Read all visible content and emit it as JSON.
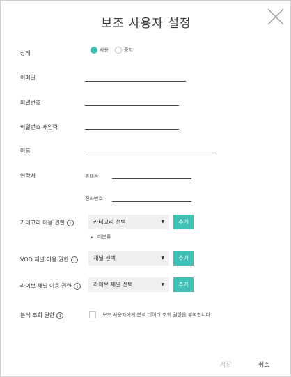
{
  "dialog": {
    "title": "보조 사용자 설정"
  },
  "fields": {
    "status": {
      "label": "상태",
      "options": [
        {
          "label": "사용",
          "checked": true
        },
        {
          "label": "중지",
          "checked": false
        }
      ]
    },
    "email": {
      "label": "이메일",
      "value": ""
    },
    "password": {
      "label": "비밀번호",
      "value": ""
    },
    "password_confirm": {
      "label": "비밀번호 재입력",
      "value": ""
    },
    "name": {
      "label": "이름",
      "value": ""
    },
    "contact": {
      "label": "연락처",
      "mobile_label": "휴대폰",
      "mobile_value": "",
      "phone_label": "전화번호",
      "phone_value": ""
    },
    "category_permission": {
      "label": "카테고리 이용 권한",
      "select_value": "카테고리 선택",
      "add_label": "추가",
      "tree_item": "미분류"
    },
    "vod_permission": {
      "label": "VOD 채널 이용 권한",
      "select_value": "채널 선택",
      "add_label": "추가"
    },
    "live_permission": {
      "label": "라이브 채널 이용 권한",
      "select_value": "라이브 채널 선택",
      "add_label": "추가"
    },
    "analytics_permission": {
      "label": "분석 조회 권한",
      "checkbox_label": "보조 사용자에게 분석 데이터 조회 권한을 부여합니다.",
      "checked": false
    }
  },
  "footer": {
    "save_label": "저장",
    "cancel_label": "취소"
  },
  "colors": {
    "accent": "#3fc1b5",
    "disabled_text": "#b5b5b5"
  },
  "icons": {
    "close": "close-icon",
    "info": "info-icon",
    "dropdown": "chevron-down-icon",
    "tree": "triangle-right-icon"
  }
}
